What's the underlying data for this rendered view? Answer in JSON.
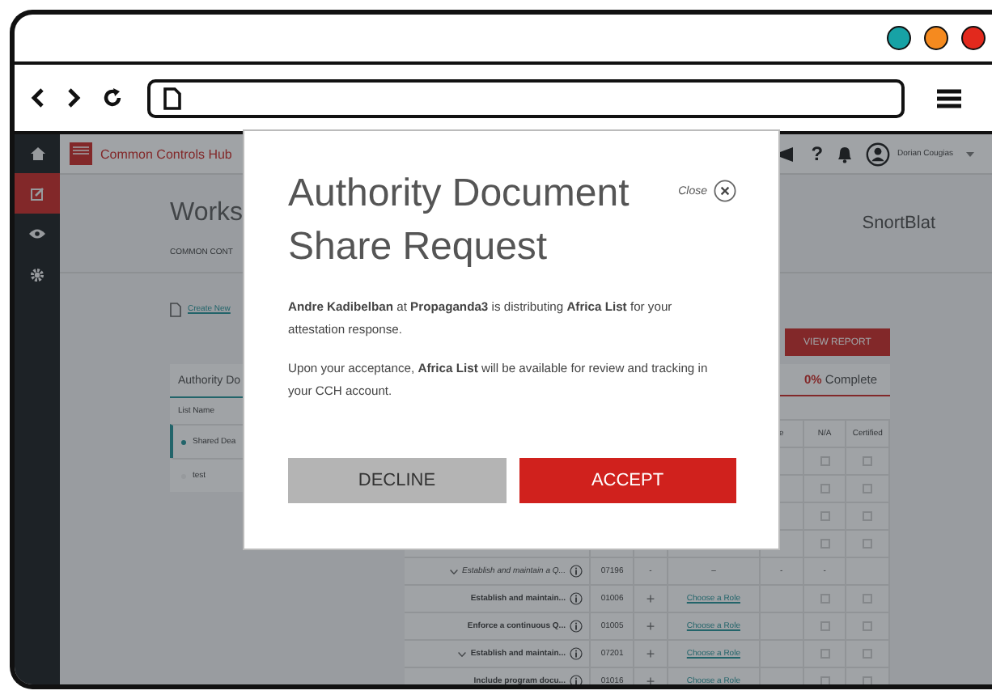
{
  "browser": {
    "window_controls": [
      {
        "color": "#17a2a5"
      },
      {
        "color": "#f58a1f"
      },
      {
        "color": "#e2291d"
      }
    ]
  },
  "app": {
    "brand": "Common Controls Hub",
    "help": "?",
    "user": "Dorian Cougias",
    "sidebar": [
      {
        "kind": "home",
        "selected": false
      },
      {
        "kind": "edit",
        "selected": true
      },
      {
        "kind": "eye",
        "selected": false
      },
      {
        "kind": "gear",
        "selected": false
      }
    ]
  },
  "page": {
    "title": "Works",
    "subtitle": "COMMON CONT",
    "create_link": "Create New",
    "organization": "SnortBlat",
    "view_report": "VIEW REPORT"
  },
  "lists_panel": {
    "tab": "Authority Do",
    "column": "List Name",
    "items": [
      {
        "name": "Shared Dea",
        "selected": true
      },
      {
        "name": "test",
        "selected": false
      }
    ]
  },
  "table": {
    "progress": "**0%** Complete",
    "columns": [
      "e",
      "N/A",
      "Certified"
    ],
    "rows": [
      {
        "kind": "covered",
        "na_checked": false,
        "certified_checked": false
      },
      {
        "kind": "covered",
        "na_checked": false,
        "certified_checked": false
      },
      {
        "kind": "covered",
        "na_checked": false,
        "certified_checked": false
      },
      {
        "kind": "covered",
        "na_checked": false,
        "certified_checked": false
      },
      {
        "kind": "summary",
        "expanded": true,
        "name": "Establish and maintain a Q...",
        "id": "07196",
        "add": "-",
        "role": "–",
        "col_e": "-",
        "na": "-"
      },
      {
        "kind": "item",
        "expanded": false,
        "name": "Establish and maintain...",
        "id": "01006",
        "add": "+",
        "role": "Choose a Role",
        "na_checked": false,
        "certified_checked": false
      },
      {
        "kind": "item",
        "expanded": false,
        "name": "Enforce a continuous Q...",
        "id": "01005",
        "add": "+",
        "role": "Choose a Role",
        "na_checked": false,
        "certified_checked": false
      },
      {
        "kind": "item",
        "expanded": true,
        "name": "Establish and maintain...",
        "id": "07201",
        "add": "+",
        "role": "Choose a Role",
        "na_checked": false,
        "certified_checked": false
      },
      {
        "kind": "item",
        "expanded": false,
        "name": "Include program docu...",
        "id": "01016",
        "add": "+",
        "role": "Choose a Role",
        "na_checked": false,
        "certified_checked": false
      }
    ]
  },
  "modal": {
    "title": "Authority Document Share Request",
    "close": "Close",
    "paragraphs": [
      "**Andre Kadibelban** at **Propaganda3** is distributing **Africa List** for your attestation response.",
      "Upon your acceptance, **Africa List** will be available for review and tracking in your CCH account."
    ],
    "buttons": [
      {
        "label": "DECLINE",
        "kind": "secondary"
      },
      {
        "label": "ACCEPT",
        "kind": "primary"
      }
    ]
  }
}
